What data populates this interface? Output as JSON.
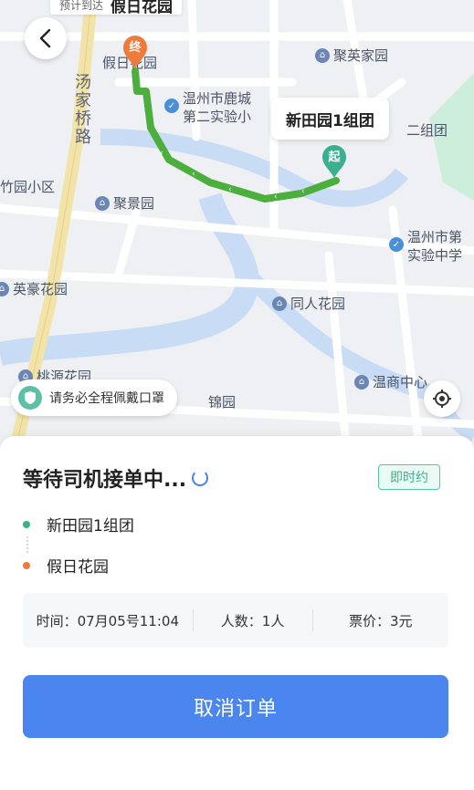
{
  "map": {
    "eta_tag": {
      "label": "预计到达",
      "dest": "假日花园"
    },
    "origin_bubble": "新田园1组团",
    "start_pin": "起",
    "end_pin": "终",
    "street_name": "汤家桥路",
    "pois": {
      "jiari": "假日花园",
      "juying": "聚英家园",
      "luchengTop": "温州市鹿城",
      "luchengBottom": "第二实验小",
      "erzutuan": "二组团",
      "zhuyuan": "竹园小区",
      "jujing": "聚景园",
      "wz_right_1": "温州市第",
      "wz_right_2": "实验中学",
      "yinghao": "英豪花园",
      "tongren": "同人花园",
      "taoyuan": "桃源花园",
      "jinyuan": "锦园",
      "wenshang": "温商中心"
    },
    "mask_tip": "请务必全程佩戴口罩",
    "colors": {
      "route": "#4caf3d",
      "water": "#c9dcf5",
      "road_main": "#f2e4a8",
      "green_area": "#cdeedb"
    }
  },
  "order": {
    "status": "等待司机接单中...",
    "badge": "即时约",
    "origin": "新田园1组团",
    "destination": "假日花园",
    "origin_color": "#3bb08f",
    "destination_color": "#f07a3c",
    "time": "时间：07月05号11:04",
    "people": "人数：1人",
    "price": "票价：3元",
    "cancel": "取消订单"
  }
}
